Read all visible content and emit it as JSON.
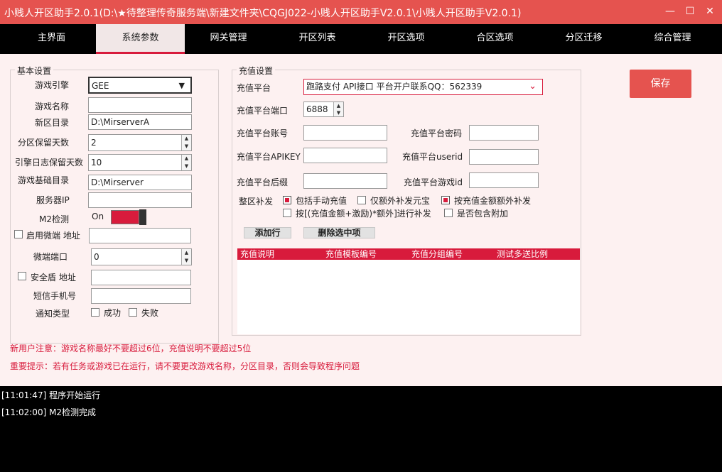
{
  "window": {
    "title": "小贱人开区助手2.0.1(D:\\★待整理传奇服务端\\新建文件夹\\CQGJ022-小贱人开区助手V2.0.1\\小贱人开区助手V2.0.1)"
  },
  "tabs": [
    "主界面",
    "系统参数",
    "网关管理",
    "开区列表",
    "开区选项",
    "合区选项",
    "分区迁移",
    "综合管理"
  ],
  "basic": {
    "title": "基本设置",
    "engine_label": "游戏引擎",
    "engine_value": "GEE",
    "gamename_label": "游戏名称",
    "gamename_value": "",
    "newdir_label": "新区目录",
    "newdir_value": "D:\\MirserverA",
    "keepdays_label": "分区保留天数",
    "keepdays_value": "2",
    "logdays_label": "引擎日志保留天数",
    "logdays_value": "10",
    "basedir_label": "游戏基础目录",
    "basedir_value": "D:\\Mirserver",
    "serverip_label": "服务器IP",
    "serverip_value": "",
    "m2_label": "M2检测",
    "m2_state": "On",
    "weiduan_label": "启用微端 地址",
    "weiduan_value": "",
    "weiport_label": "微端端口",
    "weiport_value": "0",
    "anquan_label": "安全盾 地址",
    "anquan_value": "",
    "phone_label": "短信手机号",
    "phone_value": "",
    "notify_label": "通知类型",
    "success_label": "成功",
    "fail_label": "失败"
  },
  "recharge": {
    "title": "充值设置",
    "platform_label": "充值平台",
    "platform_value": "跑路支付 API接口 平台开户联系QQ：562339",
    "port_label": "充值平台端口",
    "port_value": "6888",
    "account_label": "充值平台账号",
    "account_value": "",
    "password_label": "充值平台密码",
    "password_value": "",
    "apikey_label": "充值平台APIKEY",
    "apikey_value": "",
    "userid_label": "充值平台userid",
    "userid_value": "",
    "suffix_label": "充值平台后缀",
    "suffix_value": "",
    "gameid_label": "充值平台游戏id",
    "gameid_value": "",
    "supplement_label": "整区补发",
    "opt_manual": "包括手动充值",
    "opt_extra_yuanbao": "仅额外补发元宝",
    "opt_by_amount": "按充值金额额外补发",
    "opt_formula": "按[(充值金额+激励)*额外]进行补发",
    "opt_attach": "是否包含附加",
    "add_row": "添加行",
    "del_row": "删除选中项",
    "columns": [
      "充值说明",
      "充值模板编号",
      "充值分组编号",
      "测试多送比例"
    ]
  },
  "save_label": "保存",
  "notes": {
    "n1": "新用户注意：游戏名称最好不要超过6位，充值说明不要超过5位",
    "n2": "重要提示：若有任务或游戏已在运行，请不要更改游戏名称，分区目录，否则会导致程序问题"
  },
  "log": [
    "[11:01:47] 程序开始运行",
    "[11:02:00] M2检测完成"
  ],
  "colors": {
    "accent": "#e5534f",
    "primary": "#d81b3c"
  }
}
